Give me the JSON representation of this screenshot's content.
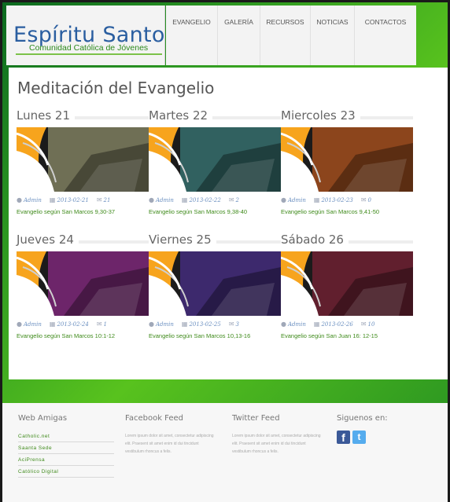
{
  "header": {
    "logo_title": "Espíritu Santo",
    "logo_subtitle": "Comunidad Católica de Jóvenes",
    "nav": [
      "EVANGELIO",
      "GALERÍA",
      "RECURSOS",
      "NOTICIAS",
      "CONTACTOS"
    ]
  },
  "main": {
    "title": "Meditación del Evangelio",
    "cards": [
      {
        "day": "Lunes 21",
        "author": "Admin",
        "date": "2013-02-21",
        "comments": "21",
        "link": "Evangelio según San Marcos 9,30-37",
        "tint": "#8c8c6a"
      },
      {
        "day": "Martes 22",
        "author": "Admin",
        "date": "2013-02-22",
        "comments": "2",
        "link": "Evangelio según San Marcos 9,38-40",
        "tint": "#3a7a78"
      },
      {
        "day": "Miercoles 23",
        "author": "Admin",
        "date": "2013-02-23",
        "comments": "0",
        "link": "Evangelio según San Marcos 9,41-50",
        "tint": "#b3541e"
      },
      {
        "day": "Jueves 24",
        "author": "Admin",
        "date": "2013-02-24",
        "comments": "1",
        "link": "Evangelio según San Marcos 10:1-12",
        "tint": "#8a2a86"
      },
      {
        "day": "Viernes 25",
        "author": "Admin",
        "date": "2013-02-25",
        "comments": "3",
        "link": "Evangelio según San Marcos 10,13-16",
        "tint": "#4a2f8a"
      },
      {
        "day": "Sábado 26",
        "author": "Admin",
        "date": "2013-02-26",
        "comments": "10",
        "link": "Evangelio según San Juan 16: 12-15",
        "tint": "#7a2235"
      }
    ]
  },
  "footer": {
    "friends_title": "Web Amigas",
    "friends": [
      "Catholic.net",
      "Saanta Sede",
      "AciPrensa",
      "Católico Digital"
    ],
    "facebook_title": "Facebook Feed",
    "facebook_text": "Lorem ipsum dolor sit amet, consectetur adipiscing elit. Praesent sit amet enim id dui tincidunt vestibulum rhoncus a felis.",
    "twitter_title": "Twitter Feed",
    "twitter_text": "Lorem ipsum dolor sit amet, consectetur adipiscing elit. Praesent sit amet enim id dui tincidunt vestibulum rhoncus a felis.",
    "social_title": "Siguenos en:",
    "facebook_icon": "f",
    "twitter_icon": "t"
  },
  "colors": {
    "brand_blue": "#2a5ea0",
    "brand_green": "#3e8a1a",
    "logo_orange": "#f7a41d"
  }
}
